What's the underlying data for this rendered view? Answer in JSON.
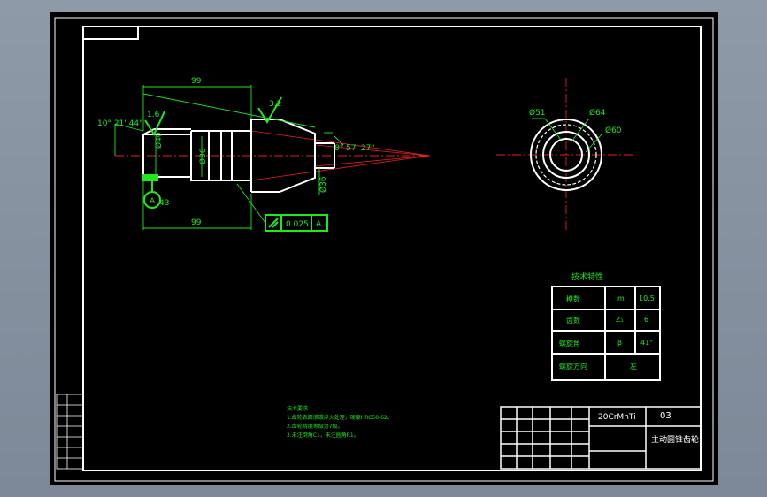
{
  "drawing": {
    "part_name": "主动圆锥齿轮",
    "material": "20CrMnTi",
    "drawing_number": "03",
    "dimensions": {
      "length_top": "99",
      "length_bottom": "99",
      "angle_left": "10° 21' 44\"",
      "angle_right": "8° 57' 27\"",
      "dia_shaft": "Ø40",
      "dia_shaft2": "Ø36",
      "dia_end": "Ø36",
      "dim_43": "43",
      "dia_51": "Ø51",
      "dia_64": "Ø64",
      "dia_60": "Ø60"
    },
    "surface_finish_1": "1.6",
    "surface_finish_2": "3.2",
    "datum_label": "A",
    "tolerance_value": "0.025",
    "tolerance_datum": "A",
    "tech_spec": {
      "title": "技术特性",
      "rows": [
        {
          "name": "模数",
          "symbol": "m",
          "value": "10.5"
        },
        {
          "name": "齿数",
          "symbol": "Z₁",
          "value": "6"
        },
        {
          "name": "螺旋角",
          "symbol": "β",
          "value": "41°"
        },
        {
          "name": "螺旋方向",
          "symbol": "",
          "value": "左"
        }
      ]
    },
    "notes": {
      "title": "技术要求",
      "lines": [
        "1.齿轮表面渗碳淬火处理，硬度HRC58-62。",
        "2.齿轮精度等级为7级。",
        "3.未注倒角C1，未注圆角R1。"
      ]
    }
  }
}
